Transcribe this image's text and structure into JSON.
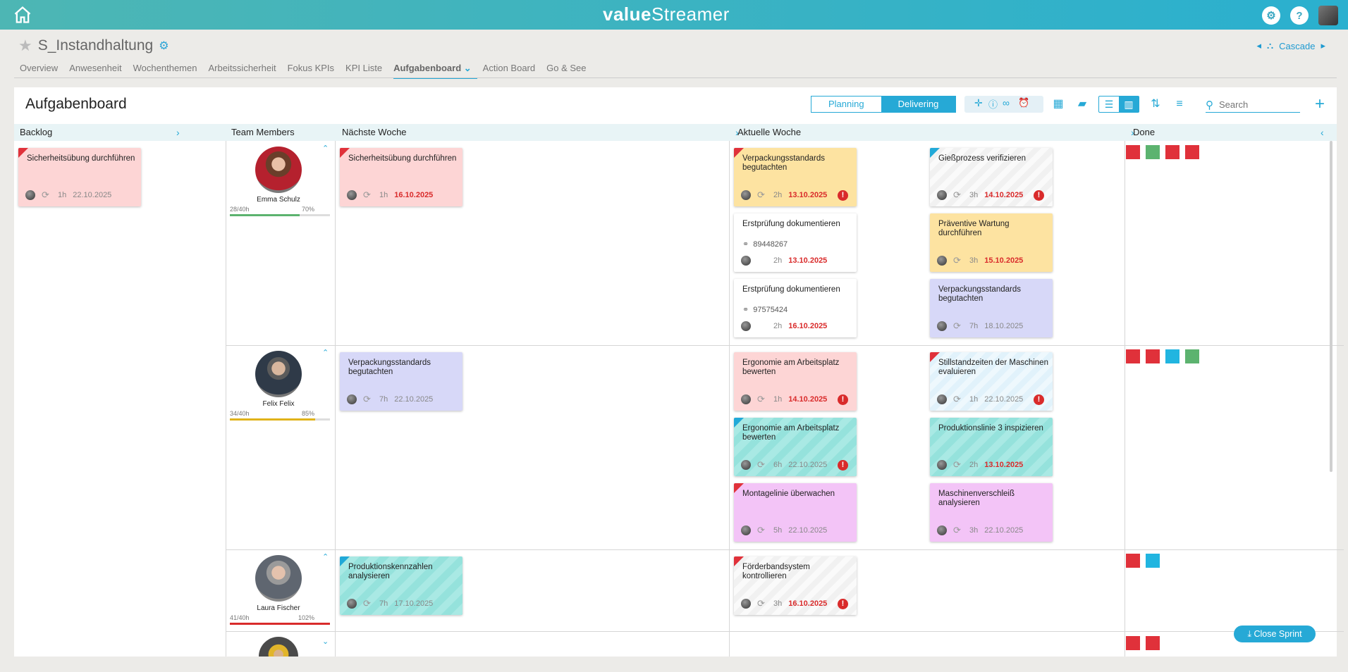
{
  "app": {
    "logo_part1": "value",
    "logo_part2": "Streamer"
  },
  "header": {
    "help_label": "?"
  },
  "page": {
    "title": "S_Instandhaltung",
    "cascade_label": "Cascade"
  },
  "nav_tabs": [
    "Overview",
    "Anwesenheit",
    "Wochenthemen",
    "Arbeitssicherheit",
    "Fokus KPIs",
    "KPI Liste",
    "Aufgabenboard",
    "Action Board",
    "Go & See"
  ],
  "active_tab": "Aufgabenboard",
  "board": {
    "title": "Aufgabenboard",
    "mode_planning": "Planning",
    "mode_delivering": "Delivering",
    "active_mode": "Delivering",
    "search_placeholder": "Search",
    "close_sprint": "Close Sprint"
  },
  "columns": {
    "backlog": "Backlog",
    "team": "Team Members",
    "next_week": "Nächste Woche",
    "current_week": "Aktuelle Woche",
    "done": "Done"
  },
  "members": [
    {
      "name": "Emma Schulz",
      "hours": "28/40h",
      "percent": "70%",
      "load": 0.7,
      "bar_color": "#5cb36f"
    },
    {
      "name": "Felix Felix",
      "hours": "34/40h",
      "percent": "85%",
      "load": 0.85,
      "bar_color": "#e0b31a"
    },
    {
      "name": "Laura Fischer",
      "hours": "41/40h",
      "percent": "102%",
      "load": 1.0,
      "bar_color": "#d92b2b"
    }
  ],
  "cards": {
    "backlog_1": {
      "title": "Sicherheitsübung durchführen",
      "hours": "1h",
      "date": "22.10.2025"
    },
    "e_next_1": {
      "title": "Sicherheitsübung durchführen",
      "hours": "1h",
      "date": "16.10.2025"
    },
    "e_cur_1": {
      "title": "Verpackungsstandards begutachten",
      "hours": "2h",
      "date": "13.10.2025"
    },
    "e_cur_2": {
      "title": "Gießprozess verifizieren",
      "hours": "3h",
      "date": "14.10.2025"
    },
    "e_cur_3": {
      "title": "Erstprüfung dokumentieren",
      "link": "89448267",
      "hours": "2h",
      "date": "13.10.2025"
    },
    "e_cur_4": {
      "title": "Präventive Wartung durchführen",
      "hours": "3h",
      "date": "15.10.2025"
    },
    "e_cur_5": {
      "title": "Erstprüfung dokumentieren",
      "link": "97575424",
      "hours": "2h",
      "date": "16.10.2025"
    },
    "e_cur_6": {
      "title": "Verpackungsstandards begutachten",
      "hours": "7h",
      "date": "18.10.2025"
    },
    "f_next_1": {
      "title": "Verpackungsstandards begutachten",
      "hours": "7h",
      "date": "22.10.2025"
    },
    "f_cur_1": {
      "title": "Ergonomie am Arbeitsplatz bewerten",
      "hours": "1h",
      "date": "14.10.2025"
    },
    "f_cur_2": {
      "title": "Stillstandzeiten der Maschinen evaluieren",
      "hours": "1h",
      "date": "22.10.2025"
    },
    "f_cur_3": {
      "title": "Ergonomie am Arbeitsplatz bewerten",
      "hours": "6h",
      "date": "22.10.2025"
    },
    "f_cur_4": {
      "title": "Produktionslinie 3 inspizieren",
      "hours": "2h",
      "date": "13.10.2025"
    },
    "f_cur_5": {
      "title": "Montagelinie überwachen",
      "hours": "5h",
      "date": "22.10.2025"
    },
    "f_cur_6": {
      "title": "Maschinenverschleiß analysieren",
      "hours": "3h",
      "date": "22.10.2025"
    },
    "l_next_1": {
      "title": "Produktionskennzahlen analysieren",
      "hours": "7h",
      "date": "17.10.2025"
    },
    "l_cur_1": {
      "title": "Förderbandsystem kontrollieren",
      "hours": "3h",
      "date": "16.10.2025"
    }
  },
  "colors": {
    "accent": "#26a9d6",
    "overdue": "#d92b2b",
    "done_red": "#e0313a",
    "done_green": "#5cb36f",
    "done_blue": "#21b5e0"
  }
}
